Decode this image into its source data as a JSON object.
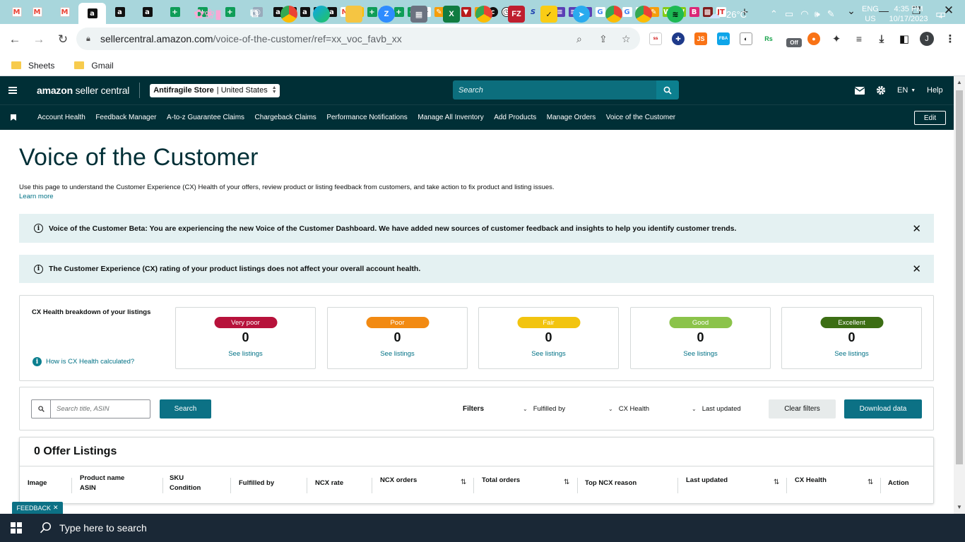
{
  "browser": {
    "tabs": [
      {
        "icon": "gmail-icon",
        "glyph": "M",
        "color": "#ea4335"
      },
      {
        "icon": "gmail-icon",
        "glyph": "M",
        "color": "#ea4335"
      },
      {
        "icon": "gmail-icon",
        "glyph": "M",
        "color": "#ea4335"
      },
      {
        "icon": "amazon-icon",
        "glyph": "a",
        "color": "#111111"
      },
      {
        "icon": "amazon-icon",
        "glyph": "a",
        "color": "#111111"
      },
      {
        "icon": "amazon-icon",
        "glyph": "a",
        "color": "#111111"
      },
      {
        "icon": "sheets-icon",
        "glyph": "+",
        "color": "#0f9d58"
      },
      {
        "icon": "sheets-icon",
        "glyph": "+",
        "color": "#0f9d58"
      },
      {
        "icon": "sheets-icon",
        "glyph": "+",
        "color": "#0f9d58"
      }
    ],
    "url_host": "sellercentral.amazon.com",
    "url_path": "/voice-of-the-customer/ref=xx_voc_favb_xx",
    "bookmarks": [
      "Sheets",
      "Gmail"
    ],
    "profile_initial": "J",
    "extensions_off_badge": "Off"
  },
  "header": {
    "logo_bold": "amazon",
    "logo_rest": " seller central",
    "store_name": "Antifragile Store",
    "store_region": "| United States",
    "search_placeholder": "Search",
    "lang": "EN",
    "help": "Help"
  },
  "nav": {
    "items": [
      "Account Health",
      "Feedback Manager",
      "A-to-z Guarantee Claims",
      "Chargeback Claims",
      "Performance Notifications",
      "Manage All Inventory",
      "Add Products",
      "Manage Orders",
      "Voice of the Customer"
    ],
    "edit_label": "Edit"
  },
  "page": {
    "title": "Voice of the Customer",
    "description": "Use this page to understand the Customer Experience (CX) Health of your offers, review product or listing feedback from customers, and take action to fix product and listing issues.",
    "learn_more": "Learn more",
    "alerts": [
      "Voice of the Customer Beta: You are experiencing the new Voice of the Customer Dashboard. We have added new sources of customer feedback and insights to help you identify customer trends.",
      "The Customer Experience (CX) rating of your product listings does not affect your overall account health."
    ]
  },
  "cx_health": {
    "title": "CX Health breakdown of your listings",
    "calc_link": "How is CX Health calculated?",
    "cards": [
      {
        "label": "Very poor",
        "count": "0",
        "link": "See listings",
        "color": "#b7123b"
      },
      {
        "label": "Poor",
        "count": "0",
        "link": "See listings",
        "color": "#f28a12"
      },
      {
        "label": "Fair",
        "count": "0",
        "link": "See listings",
        "color": "#f2c40f"
      },
      {
        "label": "Good",
        "count": "0",
        "link": "See listings",
        "color": "#8bc34a"
      },
      {
        "label": "Excellent",
        "count": "0",
        "link": "See listings",
        "color": "#3c6e14"
      }
    ]
  },
  "filters": {
    "search_placeholder": "Search title, ASIN",
    "search_button": "Search",
    "filters_label": "Filters",
    "dropdowns": [
      "Fulfilled by",
      "CX Health",
      "Last updated"
    ],
    "clear_button": "Clear filters",
    "download_button": "Download data"
  },
  "listings": {
    "title": "0 Offer Listings",
    "columns": [
      {
        "line1": "Image",
        "line2": ""
      },
      {
        "line1": "Product name",
        "line2": "ASIN"
      },
      {
        "line1": "SKU",
        "line2": "Condition"
      },
      {
        "line1": "Fulfilled by",
        "line2": ""
      },
      {
        "line1": "NCX rate",
        "line2": ""
      },
      {
        "line1": "NCX orders",
        "line2": ""
      },
      {
        "line1": "Total orders",
        "line2": ""
      },
      {
        "line1": "Top NCX reason",
        "line2": ""
      },
      {
        "line1": "Last updated",
        "line2": ""
      },
      {
        "line1": "CX Health",
        "line2": ""
      },
      {
        "line1": "Action",
        "line2": ""
      }
    ]
  },
  "feedback": "FEEDBACK",
  "taskbar": {
    "search_placeholder": "Type here to search",
    "weather": "26°C",
    "lang_line1": "ENG",
    "lang_line2": "US",
    "time": "4:35 PM",
    "date": "10/17/2023",
    "notifications": "4"
  }
}
